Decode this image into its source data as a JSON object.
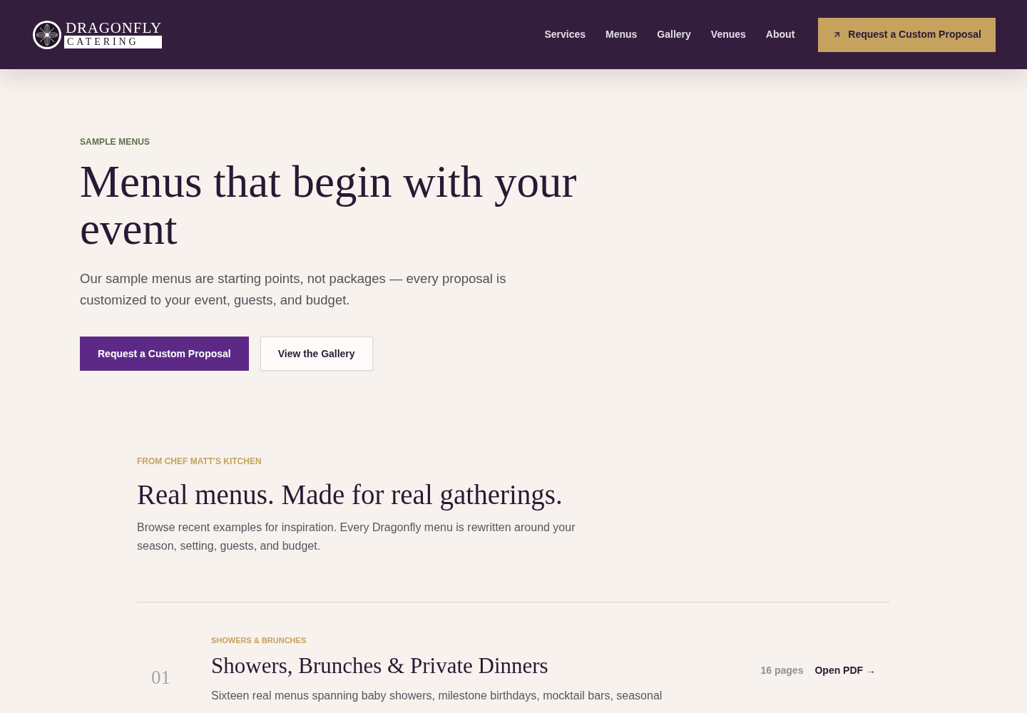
{
  "header": {
    "logo": {
      "line_1": "DRAGONFLY",
      "line_2": "CATERING"
    },
    "nav": [
      {
        "label": "Services"
      },
      {
        "label": "Menus"
      },
      {
        "label": "Gallery"
      },
      {
        "label": "Venues"
      },
      {
        "label": "About"
      }
    ],
    "cta": "Request a Custom Proposal"
  },
  "hero": {
    "eyebrow": "SAMPLE MENUS",
    "title": "Menus that begin with your event",
    "intro": "Our sample menus are starting points, not packages — every proposal is customized to your event, guests, and budget.",
    "buttons": [
      {
        "label": "Request a Custom Proposal",
        "kind": "primary"
      },
      {
        "label": "View the Gallery",
        "kind": "secondary"
      }
    ]
  },
  "collection": {
    "eyebrow": "FROM CHEF MATT'S KITCHEN",
    "title": "Real menus. Made for real gatherings.",
    "intro": "Browse recent examples for inspiration. Every Dragonfly menu is rewritten around your season, setting, guests, and budget.",
    "menus": [
      {
        "number": "01",
        "category": "SHOWERS & BRUNCHES",
        "title": "Showers, Brunches & Private Dinners",
        "description": "Sixteen real menus spanning baby showers, milestone birthdays, mocktail bars, seasonal",
        "pages": "16 pages",
        "link": "Open PDF →"
      }
    ]
  }
}
